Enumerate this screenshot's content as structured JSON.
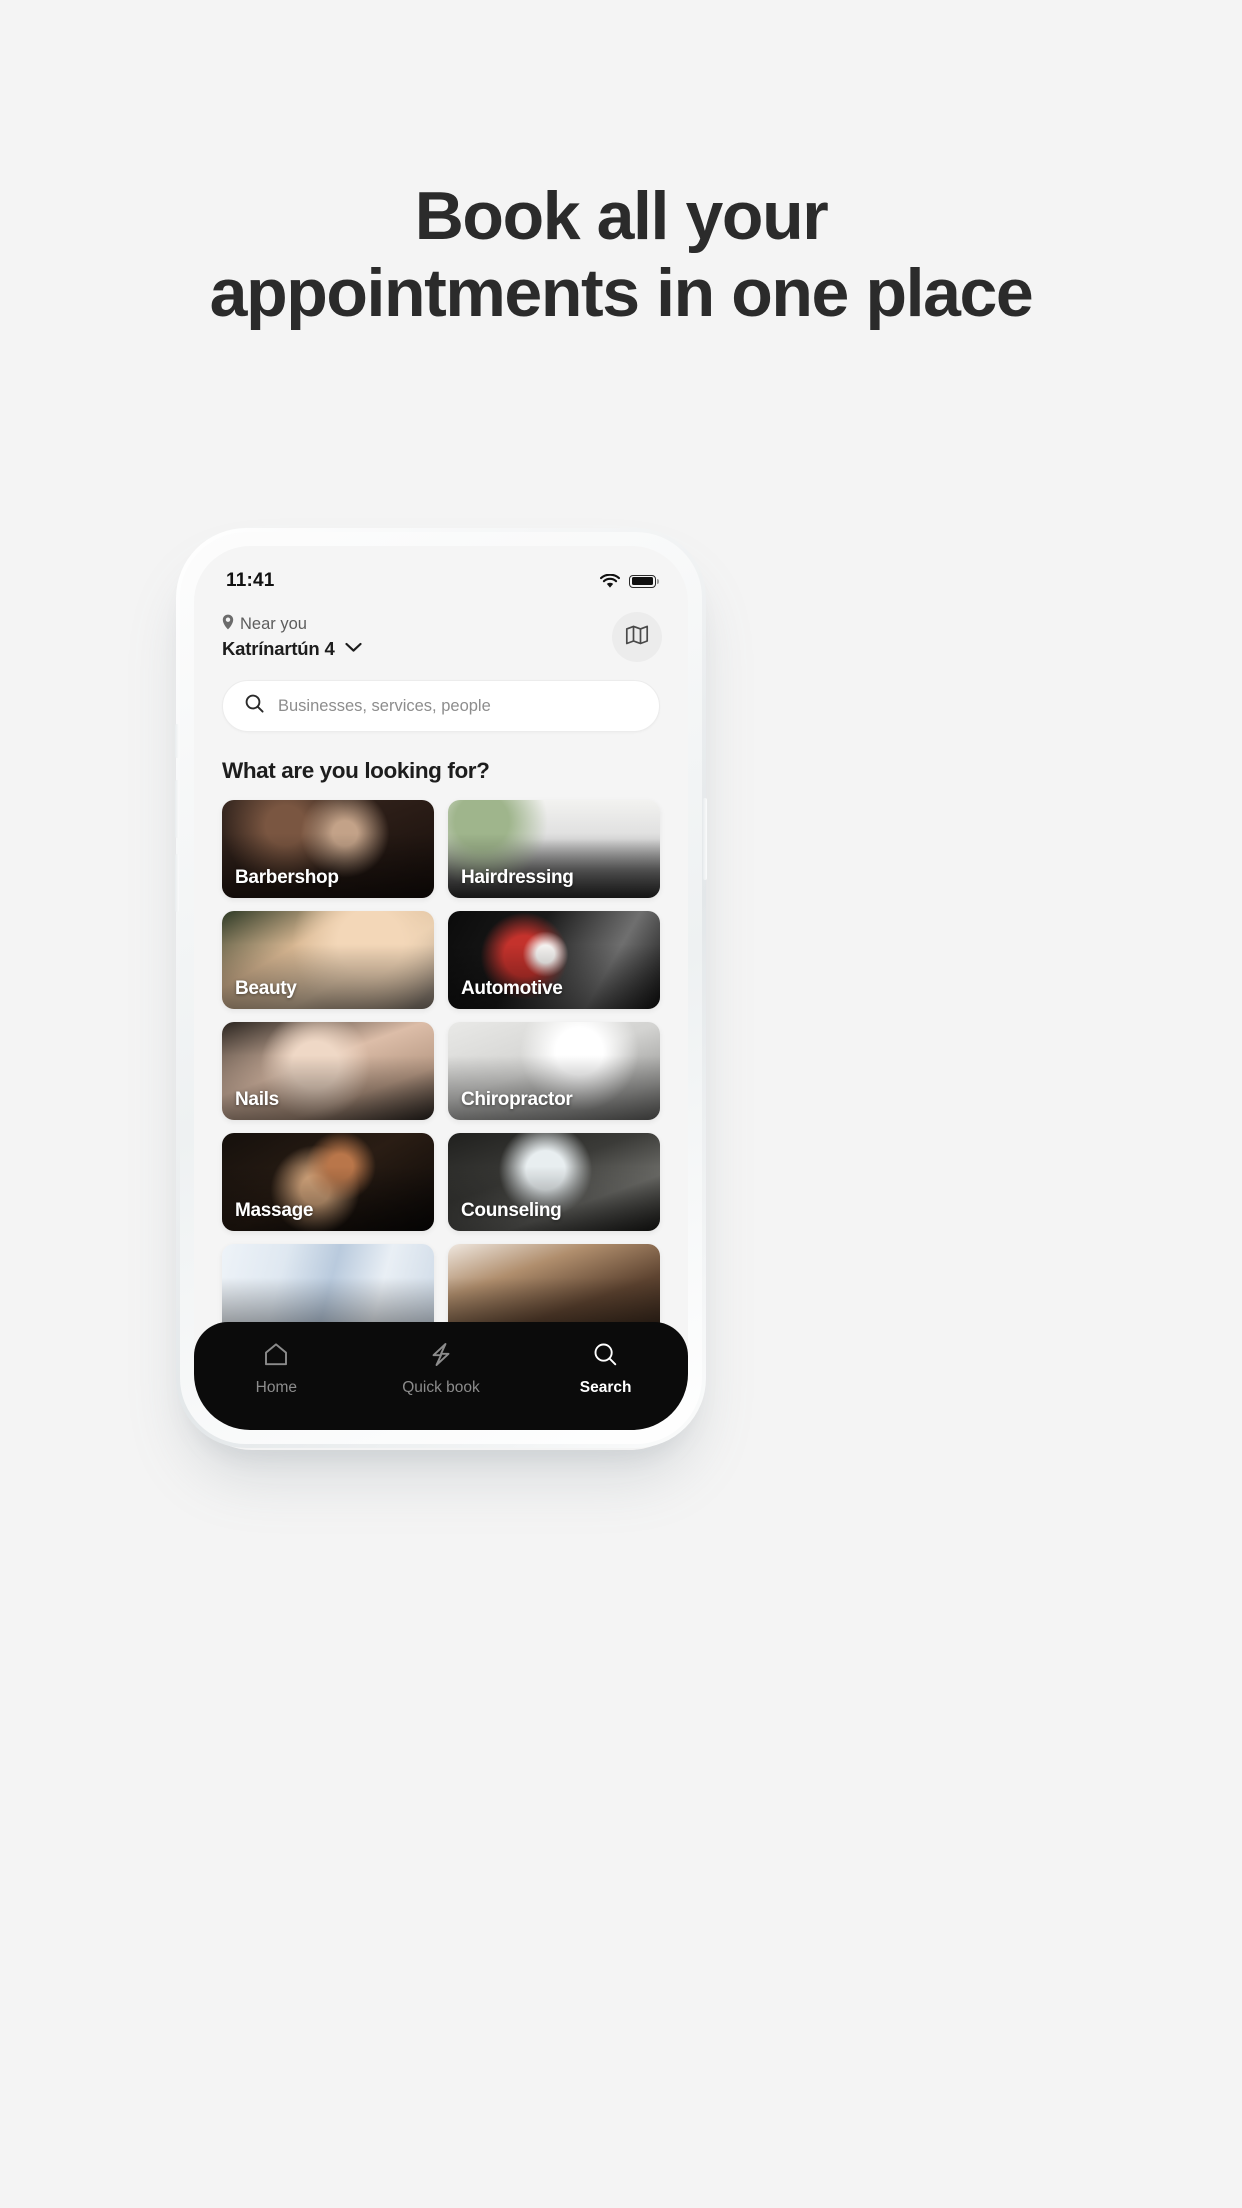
{
  "hero": {
    "line1": "Book all your",
    "line2": "appointments in one place"
  },
  "phone": {
    "status": {
      "time": "11:41",
      "wifi_icon": "wifi-icon",
      "battery_icon": "battery-full-icon"
    },
    "header": {
      "pin_icon": "map-pin-icon",
      "near_label": "Near you",
      "location": "Katrínartún 4",
      "chevron_icon": "chevron-down-icon",
      "map_icon": "map-icon"
    },
    "search": {
      "icon": "search-icon",
      "placeholder": "Businesses, services, people",
      "value": ""
    },
    "section": {
      "title": "What are you looking for?"
    },
    "categories": [
      {
        "label": "Barbershop",
        "art": "art-barbershop"
      },
      {
        "label": "Hairdressing",
        "art": "art-hairdressing"
      },
      {
        "label": "Beauty",
        "art": "art-beauty"
      },
      {
        "label": "Automotive",
        "art": "art-automotive"
      },
      {
        "label": "Nails",
        "art": "art-nails"
      },
      {
        "label": "Chiropractor",
        "art": "art-chiropractor"
      },
      {
        "label": "Massage",
        "art": "art-massage"
      },
      {
        "label": "Counseling",
        "art": "art-counseling"
      },
      {
        "label": "",
        "art": "art-extra1"
      },
      {
        "label": "",
        "art": "art-extra2"
      }
    ],
    "bottom_nav": [
      {
        "label": "Home",
        "icon": "home-icon",
        "active": false
      },
      {
        "label": "Quick book",
        "icon": "lightning-icon",
        "active": false
      },
      {
        "label": "Search",
        "icon": "search-icon",
        "active": true
      }
    ]
  },
  "colors": {
    "page_bg": "#f4f4f4",
    "headline": "#2b2b2b",
    "screen_bg": "#f5f5f5",
    "nav_bg": "#0b0b0b",
    "nav_active": "#ffffff",
    "nav_inactive": "#8c8c8c",
    "muted_text": "#5d5d5d"
  }
}
